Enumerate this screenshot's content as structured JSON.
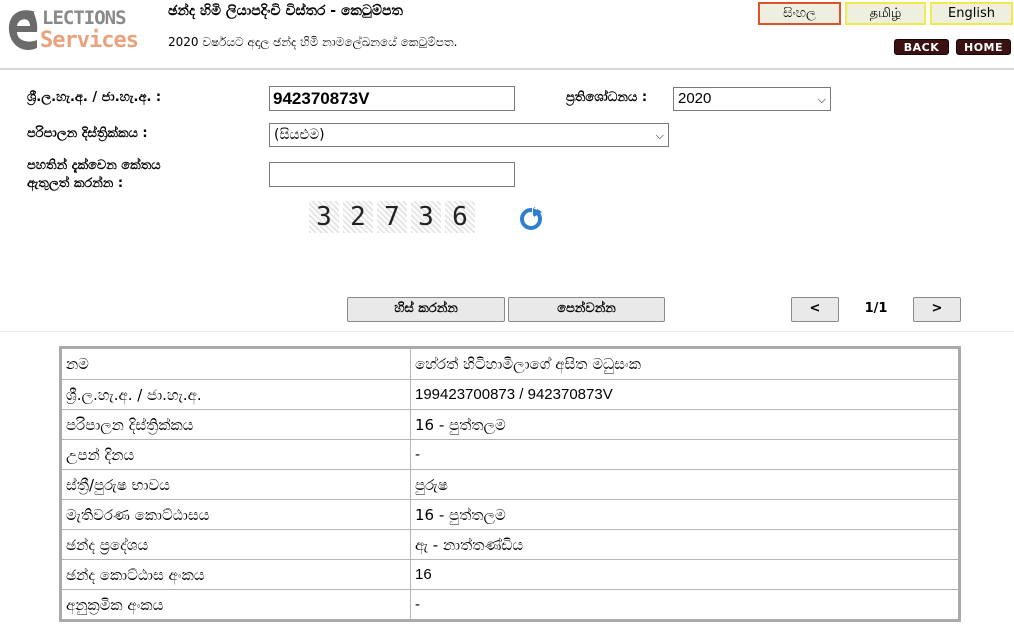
{
  "logo": {
    "top": "LECTIONS",
    "bottom": "Services"
  },
  "header": {
    "title": "ඡන්ද හිමි ලියාපදිංචි විස්තර - කෙටුම්පත",
    "subtitle": "2020 වර්ෂයට අදාල ඡන්ද හිමි නාමලේඛනයේ කෙටුම්පත.",
    "lang": {
      "sinhala": "සිංහල",
      "tamil": "தமிழ்",
      "english": "English",
      "active": "sinhala"
    },
    "back": "BACK",
    "home": "HOME"
  },
  "form": {
    "nic_label": "ශ්‍රී.ල.හැ.අ. / ජා.හැ.අ. :",
    "nic_value": "942370873V",
    "revision_label": "ප්‍රතිශෝධනය :",
    "revision_value": "2020",
    "district_label": "පරිපාලන දිස්ත්‍රික්කය :",
    "district_value": "(සියළුම)",
    "captcha_label_1": "පහතින් දැක්වෙන කේතය",
    "captcha_label_2": "ඇතුලත් කරන්න :",
    "captcha_value": "",
    "captcha_digits": [
      "3",
      "2",
      "7",
      "3",
      "6"
    ],
    "clear_button": "හිස් කරන්න",
    "show_button": "පෙන්වන්න",
    "prev_button": "<",
    "next_button": ">",
    "page_indicator": "1/1"
  },
  "result": {
    "rows": [
      {
        "key": "නම",
        "value": "හේරත් හිටිහාමිලාගේ අසිත මධුසංක"
      },
      {
        "key": "ශ්‍රී.ල.හැ.අ. / ජා.හැ.අ.",
        "value": "199423700873 / 942370873V"
      },
      {
        "key": "පරිපාලන දිස්ත්‍රික්කය",
        "value": "16 - පුත්තලම"
      },
      {
        "key": "උපන් දිනය",
        "value": "-"
      },
      {
        "key": "ස්ත්‍රී/පුරුෂ භාවය",
        "value": "පුරුෂ"
      },
      {
        "key": "මැතිවරණ කොට්ඨාසය",
        "value": "16 - පුත්තලම"
      },
      {
        "key": "ඡන්ද ප්‍රදේශය",
        "value": "ඇ - නාත්තණ්ඩිය"
      },
      {
        "key": "ඡන්ද කොට්ඨාස අංකය",
        "value": "16"
      },
      {
        "key": "අනුක්‍රමික අංකය",
        "value": "-"
      }
    ]
  },
  "colors": {
    "nav_button": "#3a1212",
    "lang_active_border": "#e0502f",
    "lang_border": "#f1ea4e",
    "logo_bottom": "#e9a27d"
  }
}
